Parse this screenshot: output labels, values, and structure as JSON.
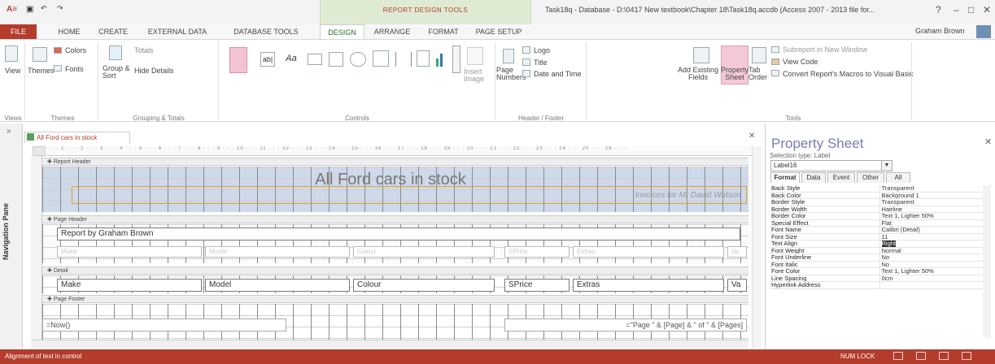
{
  "titlebar": {
    "context_label": "REPORT DESIGN TOOLS",
    "window_title": "Task18q - Database - D:\\0417 New textbook\\Chapter 18\\Task18q.accdb (Access 2007 - 2013 file for...",
    "help": "?",
    "minimize": "–",
    "restore": "□",
    "close": "✕",
    "app_icon": "A≡",
    "save_icon": "💾",
    "undo": "↶",
    "redo": "↷"
  },
  "tabs": [
    {
      "label": "FILE"
    },
    {
      "label": "HOME"
    },
    {
      "label": "CREATE"
    },
    {
      "label": "EXTERNAL DATA"
    },
    {
      "label": "DATABASE TOOLS"
    },
    {
      "label": "DESIGN"
    },
    {
      "label": "ARRANGE"
    },
    {
      "label": "FORMAT"
    },
    {
      "label": "PAGE SETUP"
    }
  ],
  "user": "Graham Brown",
  "ribbon": {
    "view": "View",
    "themes": "Themes",
    "colors": "Colors",
    "fonts": "Fonts",
    "group_sort": "Group & Sort",
    "totals": "Totals",
    "hide_details": "Hide Details",
    "insert_image": "Insert Image",
    "page_numbers": "Page Numbers",
    "logo": "Logo",
    "title": "Title",
    "date_time": "Date and Time",
    "add_existing_fields": "Add Existing Fields",
    "property_sheet": "Property Sheet",
    "tab_order": "Tab Order",
    "subreport": "Subreport in New Window",
    "view_code": "View Code",
    "convert_macros": "Convert Report's Macros to Visual Basic",
    "groups": {
      "views": "Views",
      "themes": "Themes",
      "grouping": "Grouping & Totals",
      "controls": "Controls",
      "header_footer": "Header / Footer",
      "tools": "Tools"
    }
  },
  "nav_pane": "Navigation Pane",
  "document": {
    "tab_label": "All Ford cars in stock",
    "ruler": "· · · 1 · · · 2 · · · 3 · · · 4 · · · 5 · · · 6 · · · 7 · · · 8 · · · 9 · · · 10 · · · 11 · · · 12 · · · 13 · · · 14 · · · 15 · · · 16 · · · 17 · · · 18 · · · 19 · · · 20 · · · 21 · · · 22 · · · 23 · · · 24 · · · 25 · · · 26 · · ·",
    "sections": {
      "report_header": "Report Header",
      "page_header": "Page Header",
      "detail": "Detail",
      "page_footer": "Page Footer"
    },
    "report_title": "All Ford cars in stock",
    "report_subtitle": "Invoices for Mr David Watson",
    "report_by": "Report by Graham Brown",
    "ghost_labels": [
      "Make",
      "Model",
      "Colour",
      "SPrice",
      "Extras",
      "Va"
    ],
    "detail_fields": [
      "Make",
      "Model",
      "Colour",
      "SPrice",
      "Extras",
      "Va"
    ],
    "now_expr": "=Now()",
    "page_expr": "=\"Page \" & [Page] & \" of \" & [Pages]"
  },
  "property_sheet": {
    "title": "Property Sheet",
    "selection_type": "Selection type: Label",
    "selected": "Label16",
    "tabs": [
      "Format",
      "Data",
      "Event",
      "Other",
      "All"
    ],
    "rows": [
      {
        "k": "Back Style",
        "v": "Transparent"
      },
      {
        "k": "Back Color",
        "v": "Background 1"
      },
      {
        "k": "Border Style",
        "v": "Transparent"
      },
      {
        "k": "Border Width",
        "v": "Hairline"
      },
      {
        "k": "Border Color",
        "v": "Text 1, Lighter 50%"
      },
      {
        "k": "Special Effect",
        "v": "Flat"
      },
      {
        "k": "Font Name",
        "v": "Calibri (Detail)"
      },
      {
        "k": "Font Size",
        "v": "11"
      },
      {
        "k": "Text Align",
        "v": "Right"
      },
      {
        "k": "Font Weight",
        "v": "Normal"
      },
      {
        "k": "Font Underline",
        "v": "No"
      },
      {
        "k": "Font Italic",
        "v": "No"
      },
      {
        "k": "Fore Color",
        "v": "Text 1, Lighter 50%"
      },
      {
        "k": "Line Spacing",
        "v": "0cm"
      },
      {
        "k": "Hyperlink Address",
        "v": ""
      }
    ]
  },
  "statusbar": {
    "text": "Alignment of text in control",
    "numlock": "NUM LOCK"
  },
  "colors": {
    "accent": "#b43c2c",
    "context_tab": "#dfead3",
    "report_header_bg": "#ced9ea"
  }
}
